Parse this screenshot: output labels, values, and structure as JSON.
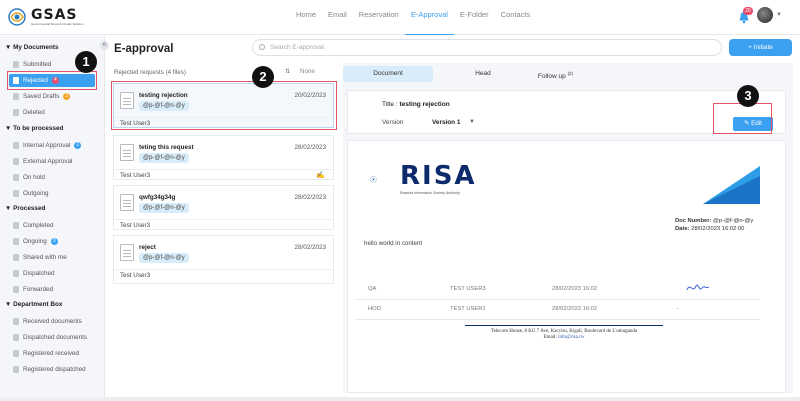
{
  "topbar": {
    "logo_text": "GSAS",
    "logo_sub": "Governmental Smart & Cloudy Solution",
    "nav": [
      "Home",
      "Email",
      "Reservation",
      "E-Approval",
      "E-Folder",
      "Contacts"
    ],
    "active_nav": "E-Approval",
    "notification_count": "20"
  },
  "sidebar": {
    "my_documents": {
      "title": "My Documents",
      "items": [
        {
          "label": "Submitted",
          "count": ""
        },
        {
          "label": "Rejected",
          "count": "4"
        },
        {
          "label": "Saved Drafts",
          "count": "2"
        },
        {
          "label": "Deleted",
          "count": ""
        }
      ]
    },
    "to_be_processed": {
      "title": "To be processed",
      "items": [
        {
          "label": "Internal Approval",
          "count": "1"
        },
        {
          "label": "External Approval",
          "count": ""
        },
        {
          "label": "On hold",
          "count": ""
        },
        {
          "label": "Outgoing",
          "count": ""
        }
      ]
    },
    "processed": {
      "title": "Processed",
      "items": [
        {
          "label": "Completed",
          "count": ""
        },
        {
          "label": "Ongoing",
          "count": "3"
        },
        {
          "label": "Shared with me",
          "count": ""
        },
        {
          "label": "Dispatched",
          "count": ""
        },
        {
          "label": "Forwarded",
          "count": ""
        }
      ]
    },
    "department_box": {
      "title": "Department Box",
      "items": [
        {
          "label": "Received documents"
        },
        {
          "label": "Dispatched documents"
        },
        {
          "label": "Registered received"
        },
        {
          "label": "Registered dispatched"
        }
      ]
    }
  },
  "main": {
    "title": "E-approval",
    "search_placeholder": "Search E-approval",
    "initiate_label": "+ Initiate",
    "list_header": "Rejected requests (4 files)",
    "sort_label": "None"
  },
  "requests": [
    {
      "title": "testing rejection",
      "date": "20/02/2023",
      "tag": "@p-@f-@n-@y",
      "user": "Test User3"
    },
    {
      "title": "teting this request",
      "date": "28/02/2023",
      "tag": "@p-@f-@n-@y",
      "user": "Test User3"
    },
    {
      "title": "qwfg34g34g",
      "date": "28/02/2023",
      "tag": "@p-@f-@n-@y",
      "user": "Test User3"
    },
    {
      "title": "reject",
      "date": "28/02/2023",
      "tag": "@p-@f-@n-@y",
      "user": "Test User3"
    }
  ],
  "doc_tabs": {
    "document": "Document",
    "head": "Head",
    "follow_up": "Follow up",
    "follow_up_count": "(2)"
  },
  "doc_info": {
    "title_label": "Title :",
    "title_value": "testing rejection",
    "version_label": "Version",
    "version_value": "Version 1",
    "edit_label": "Edit"
  },
  "paper": {
    "brand": "RISA",
    "brand_sub": "Rwanda Information Society Authority",
    "doc_number_label": "Doc Number:",
    "doc_number_value": "@p-@f-@n-@y",
    "date_label": "Date:",
    "date_value": "28/02/2023 16:02:00",
    "body": "hello world in content",
    "signatures": [
      {
        "role": "QA",
        "user": "TEST USER3",
        "date": "28/02/2023 16:02",
        "signed": "true"
      },
      {
        "role": "HOD",
        "user": "TEST USER1",
        "date": "28/02/2023 16:02",
        "signed": "-"
      }
    ],
    "footer_address": "Telecom House, 8 KG 7 Ave, Kacyiru, Kigali, Boulevard de L'umuganda",
    "footer_email_label": "Email:",
    "footer_email": "info@risa.rw"
  },
  "callouts": [
    "1",
    "2",
    "3"
  ],
  "colors": {
    "accent": "#3aa0ef",
    "danger": "#e84c6a",
    "warning": "#f5a623",
    "highlight": "#e05565"
  }
}
